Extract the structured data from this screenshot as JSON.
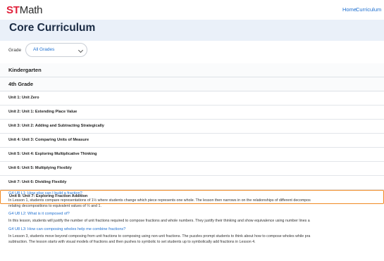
{
  "brand": {
    "st": "ST",
    "math": "Math",
    "st_color": "#e0203a"
  },
  "nav": {
    "home": "Home",
    "curriculum": "Curriculum"
  },
  "page": {
    "title": "Core Curriculum"
  },
  "filter": {
    "label": "Grade",
    "selected": "All Grades"
  },
  "grades": [
    "Kindergarten",
    "4th Grade"
  ],
  "units": [
    "Unit 1: Unit Zero",
    "Unit 2: Unit 1: Extending Place Value",
    "Unit 3: Unit 2: Adding and Subtracting Strategically",
    "Unit 4: Unit 3: Comparing Units of Measure",
    "Unit 5: Unit 4: Exploring Multiplicative Thinking",
    "Unit 6: Unit 5: Multiplying Flexibly",
    "Unit 7: Unit 6: Dividing Flexibly",
    "Unit 8: Unit 7: Exploring Fraction Addition"
  ],
  "lessons": [
    {
      "title": "G4 U8 L1: How else can I build a fraction?",
      "desc": [
        "In Lesson 1, students compare representations of 1½ where students change which piece represents one whole. The lesson then narrows in on the relationships of different decompos",
        "relating decompositions to equivalent values of ½ and 1."
      ]
    },
    {
      "title": "G4 U8 L2: What is it composed of?",
      "desc": [
        "In this lesson, students will justify the number of unit fractions required to compose fractions and whole numbers.  They justify their thinking and show equivalence using number lines a"
      ]
    },
    {
      "title": "G4 U8 L3: How can composing wholes help me combine fractions?",
      "desc": [
        "In Lesson 3, students move beyond composing from unit fractions to composing using non-unit fractions. The puzzles prompt students to think about how to compose wholes while pra",
        "subtraction. The lesson starts with visual models of fractions and then pushes to symbolic to set students up to symbolically add fractions in Lesson 4."
      ]
    }
  ]
}
